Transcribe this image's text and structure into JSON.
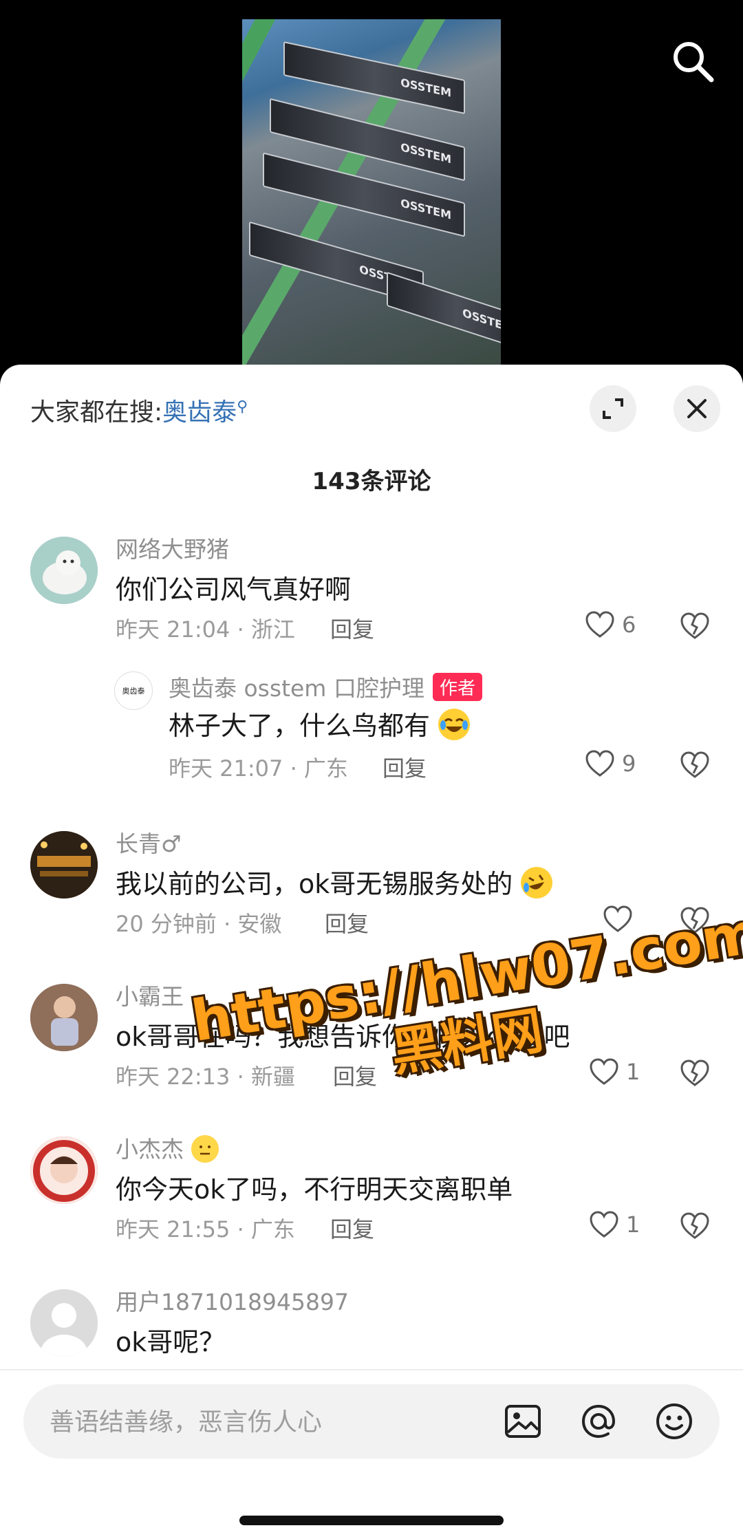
{
  "search_bar": {
    "prefix": "大家都在搜:",
    "keyword": "奥齿泰"
  },
  "comment_count": "143条评论",
  "comments": [
    {
      "user": "网络大野猪",
      "text": "你们公司风气真好啊",
      "meta": "昨天 21:04 · 浙江",
      "reply": "回复",
      "likes": "6",
      "replies": [
        {
          "user": "奥齿泰 osstem 口腔护理",
          "avatar_text": "奥齿泰",
          "badge": "作者",
          "text": "林子大了，什么鸟都有",
          "meta": "昨天 21:07 · 广东",
          "reply": "回复",
          "likes": "9"
        }
      ]
    },
    {
      "user": "长青♂",
      "text": "我以前的公司，ok哥无锡服务处的",
      "meta": "20 分钟前 · 安徽",
      "reply": "回复",
      "likes": ""
    },
    {
      "user": "小霸王",
      "text": "ok哥哥在吗？我想告诉你，快来ok我吧",
      "meta": "昨天 22:13 · 新疆",
      "reply": "回复",
      "likes": "1"
    },
    {
      "user": "小杰杰",
      "text": "你今天ok了吗，不行明天交离职单",
      "meta": "昨天 21:55 · 广东",
      "reply": "回复",
      "likes": "1"
    },
    {
      "user": "用户1871018945897",
      "text": "ok哥呢？"
    }
  ],
  "watermark": {
    "line1": "https://hlw07.com",
    "line2": "黑料网"
  },
  "input": {
    "placeholder": "善语结善缘，恶言伤人心"
  },
  "video": {
    "box_brand": "OSSTEM"
  },
  "colors": {
    "accent_blue": "#3672b5",
    "author_badge": "#fe2c55",
    "watermark": "#ff9f1a"
  }
}
